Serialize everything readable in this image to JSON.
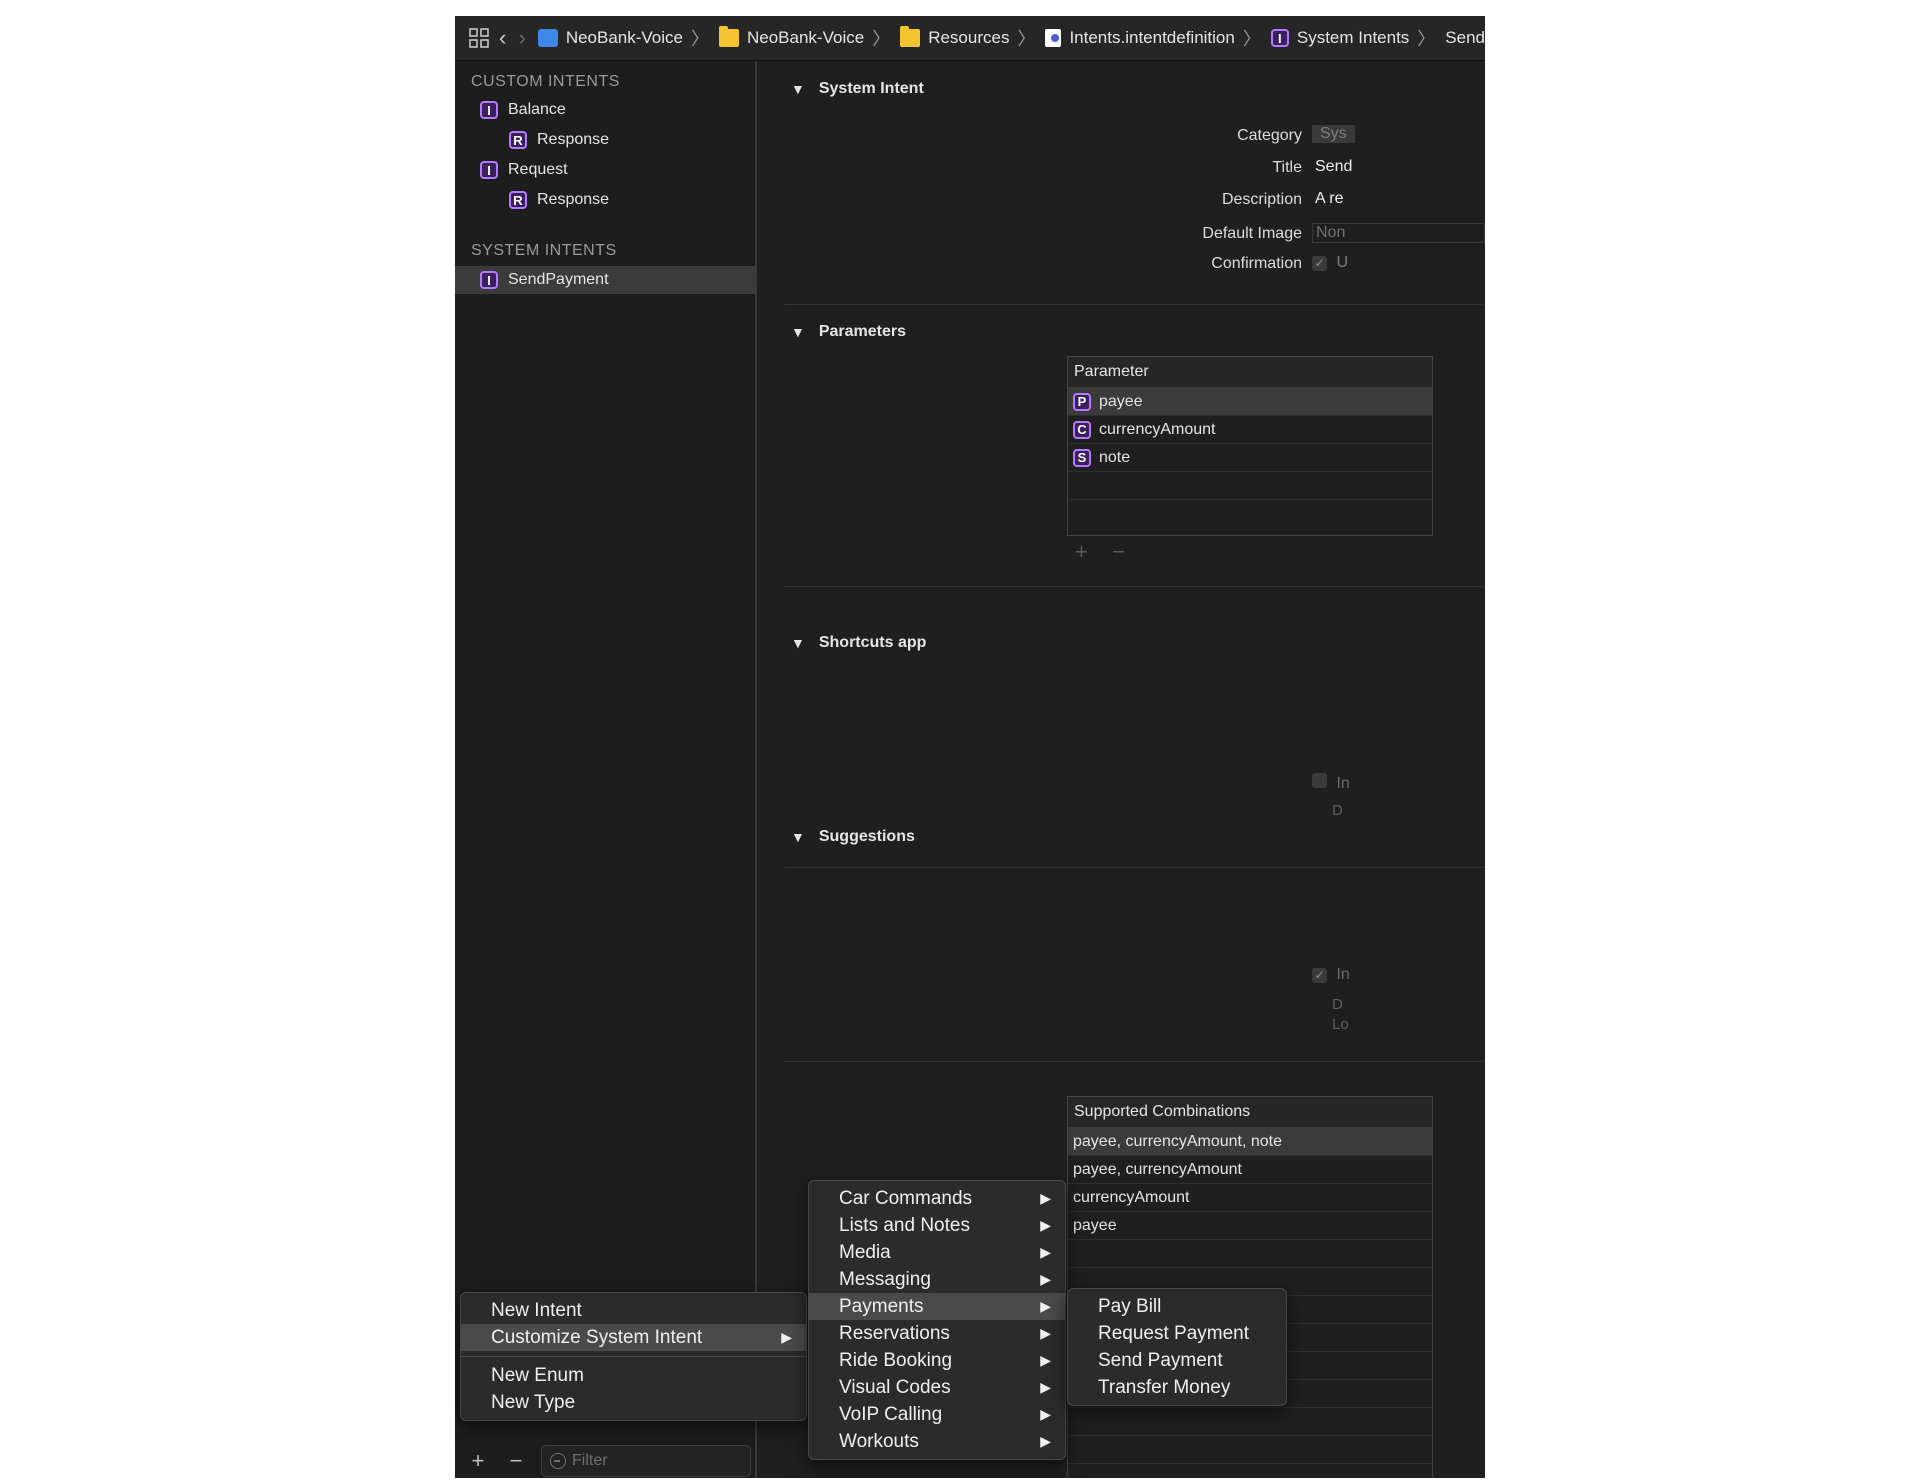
{
  "jumpbar": {
    "crumbs": [
      "NeoBank-Voice",
      "NeoBank-Voice",
      "Resources",
      "Intents.intentdefinition",
      "System Intents",
      "Send"
    ]
  },
  "sidebar": {
    "custom_header": "CUSTOM INTENTS",
    "custom_items": [
      {
        "badge": "I",
        "label": "Balance"
      },
      {
        "badge": "R",
        "label": "Response"
      },
      {
        "badge": "I",
        "label": "Request"
      },
      {
        "badge": "R",
        "label": "Response"
      }
    ],
    "system_header": "SYSTEM INTENTS",
    "system_items": [
      {
        "badge": "I",
        "label": "SendPayment"
      }
    ],
    "filter_placeholder": "Filter"
  },
  "system_intent": {
    "header": "System Intent",
    "category_label": "Category",
    "category_value": "Sys",
    "title_label": "Title",
    "title_value": "Send",
    "description_label": "Description",
    "description_value": "A re",
    "default_image_label": "Default Image",
    "default_image_value": "Non",
    "confirmation_label": "Confirmation",
    "confirmation_value": "U"
  },
  "parameters": {
    "header": "Parameters",
    "column": "Parameter",
    "rows": [
      {
        "badge": "P",
        "name": "payee"
      },
      {
        "badge": "C",
        "name": "currencyAmount"
      },
      {
        "badge": "S",
        "name": "note"
      }
    ]
  },
  "shortcuts": {
    "header": "Shortcuts app",
    "check_text": "In",
    "sub_text": "D"
  },
  "suggestions": {
    "header": "Suggestions",
    "check_text": "In",
    "sub_text_1": "D",
    "sub_text_2": "Lo",
    "column": "Supported Combinations",
    "rows": [
      "payee, currencyAmount, note",
      "payee, currencyAmount",
      "currencyAmount",
      "payee"
    ]
  },
  "menu_main": {
    "items": [
      "New Intent",
      "Customize System Intent",
      "New Enum",
      "New Type"
    ]
  },
  "menu_categories": {
    "items": [
      "Car Commands",
      "Lists and Notes",
      "Media",
      "Messaging",
      "Payments",
      "Reservations",
      "Ride Booking",
      "Visual Codes",
      "VoIP Calling",
      "Workouts"
    ]
  },
  "menu_payments": {
    "items": [
      "Pay Bill",
      "Request Payment",
      "Send Payment",
      "Transfer Money"
    ]
  },
  "colors": {
    "badge_border": "#b57bff",
    "selection": "#3b3b3b",
    "menu_highlight": "#4a4a4a"
  }
}
